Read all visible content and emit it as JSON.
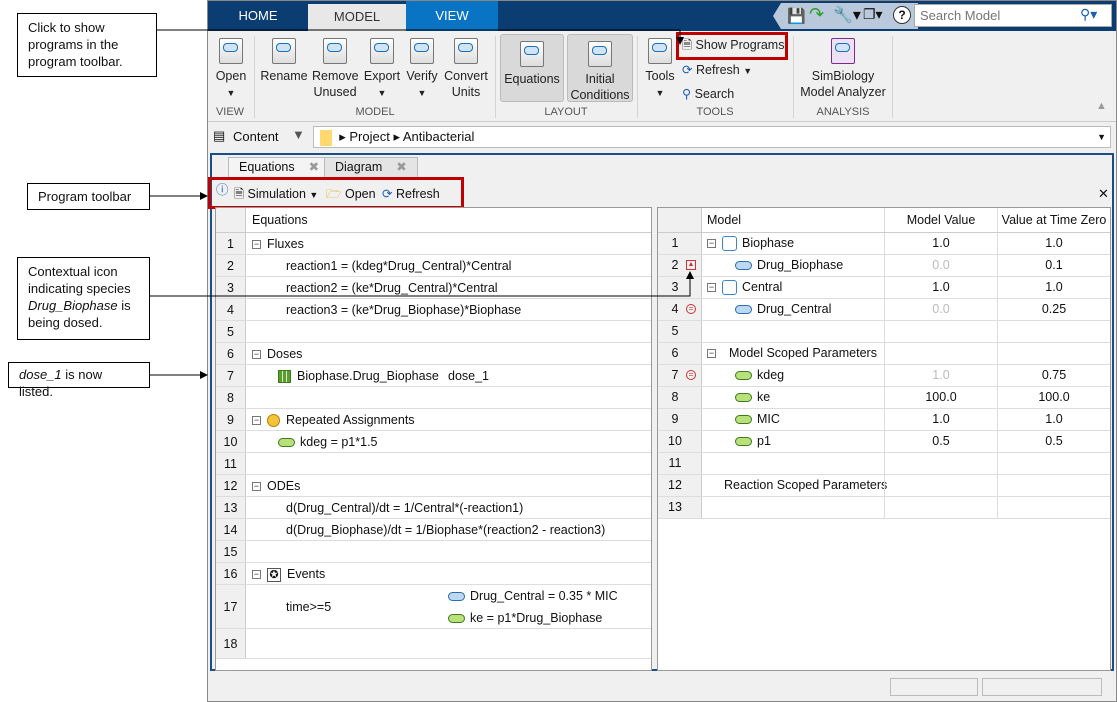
{
  "annotations": {
    "show_programs": "Click to show programs in the program toolbar.",
    "program_toolbar": "Program toolbar",
    "contextual_pre": "Contextual icon indicating species ",
    "contextual_species": "Drug_Biophase",
    "contextual_post": " is being dosed.",
    "dose_name": "dose_1",
    "dose_post": " is now listed."
  },
  "tabs": [
    "HOME",
    "MODEL",
    "VIEW"
  ],
  "search": {
    "placeholder": "Search Model"
  },
  "ribbon": {
    "open": "Open",
    "rename": "Rename",
    "remove1": "Remove",
    "remove2": "Unused",
    "export": "Export",
    "verify": "Verify",
    "convert1": "Convert",
    "convert2": "Units",
    "equations": "Equations",
    "initial1": "Initial",
    "initial2": "Conditions",
    "tools": "Tools",
    "show_programs": "Show Programs",
    "refresh": "Refresh",
    "search": "Search",
    "analyzer1": "SimBiology",
    "analyzer2": "Model Analyzer",
    "sections": {
      "view": "VIEW",
      "model": "MODEL",
      "layout": "LAYOUT",
      "tools": "TOOLS",
      "analysis": "ANALYSIS"
    }
  },
  "address": {
    "content": "Content",
    "crumbs": [
      "Project",
      "Antibacterial"
    ]
  },
  "doc_tabs": [
    "Equations",
    "Diagram"
  ],
  "program_toolbar": {
    "simulation": "Simulation",
    "open": "Open",
    "refresh": "Refresh"
  },
  "equations": {
    "header": "Equations",
    "rows": [
      {
        "n": "1",
        "text": "Fluxes",
        "group": true
      },
      {
        "n": "2",
        "text": "reaction1 = (kdeg*Drug_Central)*Central"
      },
      {
        "n": "3",
        "text": "reaction2 = (ke*Drug_Central)*Central"
      },
      {
        "n": "4",
        "text": "reaction3 = (ke*Drug_Biophase)*Biophase"
      },
      {
        "n": "5",
        "text": ""
      },
      {
        "n": "6",
        "text": "Doses",
        "group": true
      },
      {
        "n": "7",
        "text": "Biophase.Drug_Biophase",
        "extra": "dose_1",
        "icon": "dose-table"
      },
      {
        "n": "8",
        "text": ""
      },
      {
        "n": "9",
        "text": "Repeated Assignments",
        "group": true,
        "icon": "repeated-assignment"
      },
      {
        "n": "10",
        "text": "kdeg = p1*1.5",
        "icon": "parameter"
      },
      {
        "n": "11",
        "text": ""
      },
      {
        "n": "12",
        "text": "ODEs",
        "group": true
      },
      {
        "n": "13",
        "text": "d(Drug_Central)/dt = 1/Central*(-reaction1)"
      },
      {
        "n": "14",
        "text": "d(Drug_Biophase)/dt = 1/Biophase*(reaction2 - reaction3)"
      },
      {
        "n": "15",
        "text": ""
      },
      {
        "n": "16",
        "text": "Events",
        "group": true,
        "icon": "event"
      },
      {
        "n": "17",
        "text": "time>=5",
        "event1": "Drug_Central = 0.35 * MIC",
        "event2": "ke = p1*Drug_Biophase"
      },
      {
        "n": "18",
        "text": ""
      }
    ]
  },
  "model_table": {
    "headers": [
      "Model",
      "Model Value",
      "Value at Time Zero"
    ],
    "rows": [
      {
        "n": "1",
        "name": "Biophase",
        "type": "compartment",
        "value": "1.0",
        "t0": "1.0"
      },
      {
        "n": "2",
        "name": "Drug_Biophase",
        "type": "species",
        "value": "0.0",
        "t0": "0.1",
        "value_gray": true,
        "marker": "dose"
      },
      {
        "n": "3",
        "name": "Central",
        "type": "compartment",
        "value": "1.0",
        "t0": "1.0"
      },
      {
        "n": "4",
        "name": "Drug_Central",
        "type": "species",
        "value": "0.0",
        "t0": "0.25",
        "value_gray": true,
        "marker": "assignment"
      },
      {
        "n": "5",
        "name": "",
        "type": "",
        "value": "",
        "t0": ""
      },
      {
        "n": "6",
        "name": "Model Scoped Parameters",
        "type": "group",
        "value": "",
        "t0": ""
      },
      {
        "n": "7",
        "name": "kdeg",
        "type": "parameter",
        "value": "1.0",
        "t0": "0.75",
        "value_gray": true,
        "marker": "assignment"
      },
      {
        "n": "8",
        "name": "ke",
        "type": "parameter",
        "value": "100.0",
        "t0": "100.0"
      },
      {
        "n": "9",
        "name": "MIC",
        "type": "parameter",
        "value": "1.0",
        "t0": "1.0"
      },
      {
        "n": "10",
        "name": "p1",
        "type": "parameter",
        "value": "0.5",
        "t0": "0.5"
      },
      {
        "n": "11",
        "name": "",
        "type": "",
        "value": "",
        "t0": ""
      },
      {
        "n": "12",
        "name": "Reaction Scoped Parameters",
        "type": "label",
        "value": "",
        "t0": ""
      },
      {
        "n": "13",
        "name": "",
        "type": "",
        "value": "",
        "t0": ""
      }
    ]
  },
  "colors": {
    "titlebar": "#0b3d73",
    "active_tab": "#0a74c4",
    "highlight": "#c00000"
  }
}
